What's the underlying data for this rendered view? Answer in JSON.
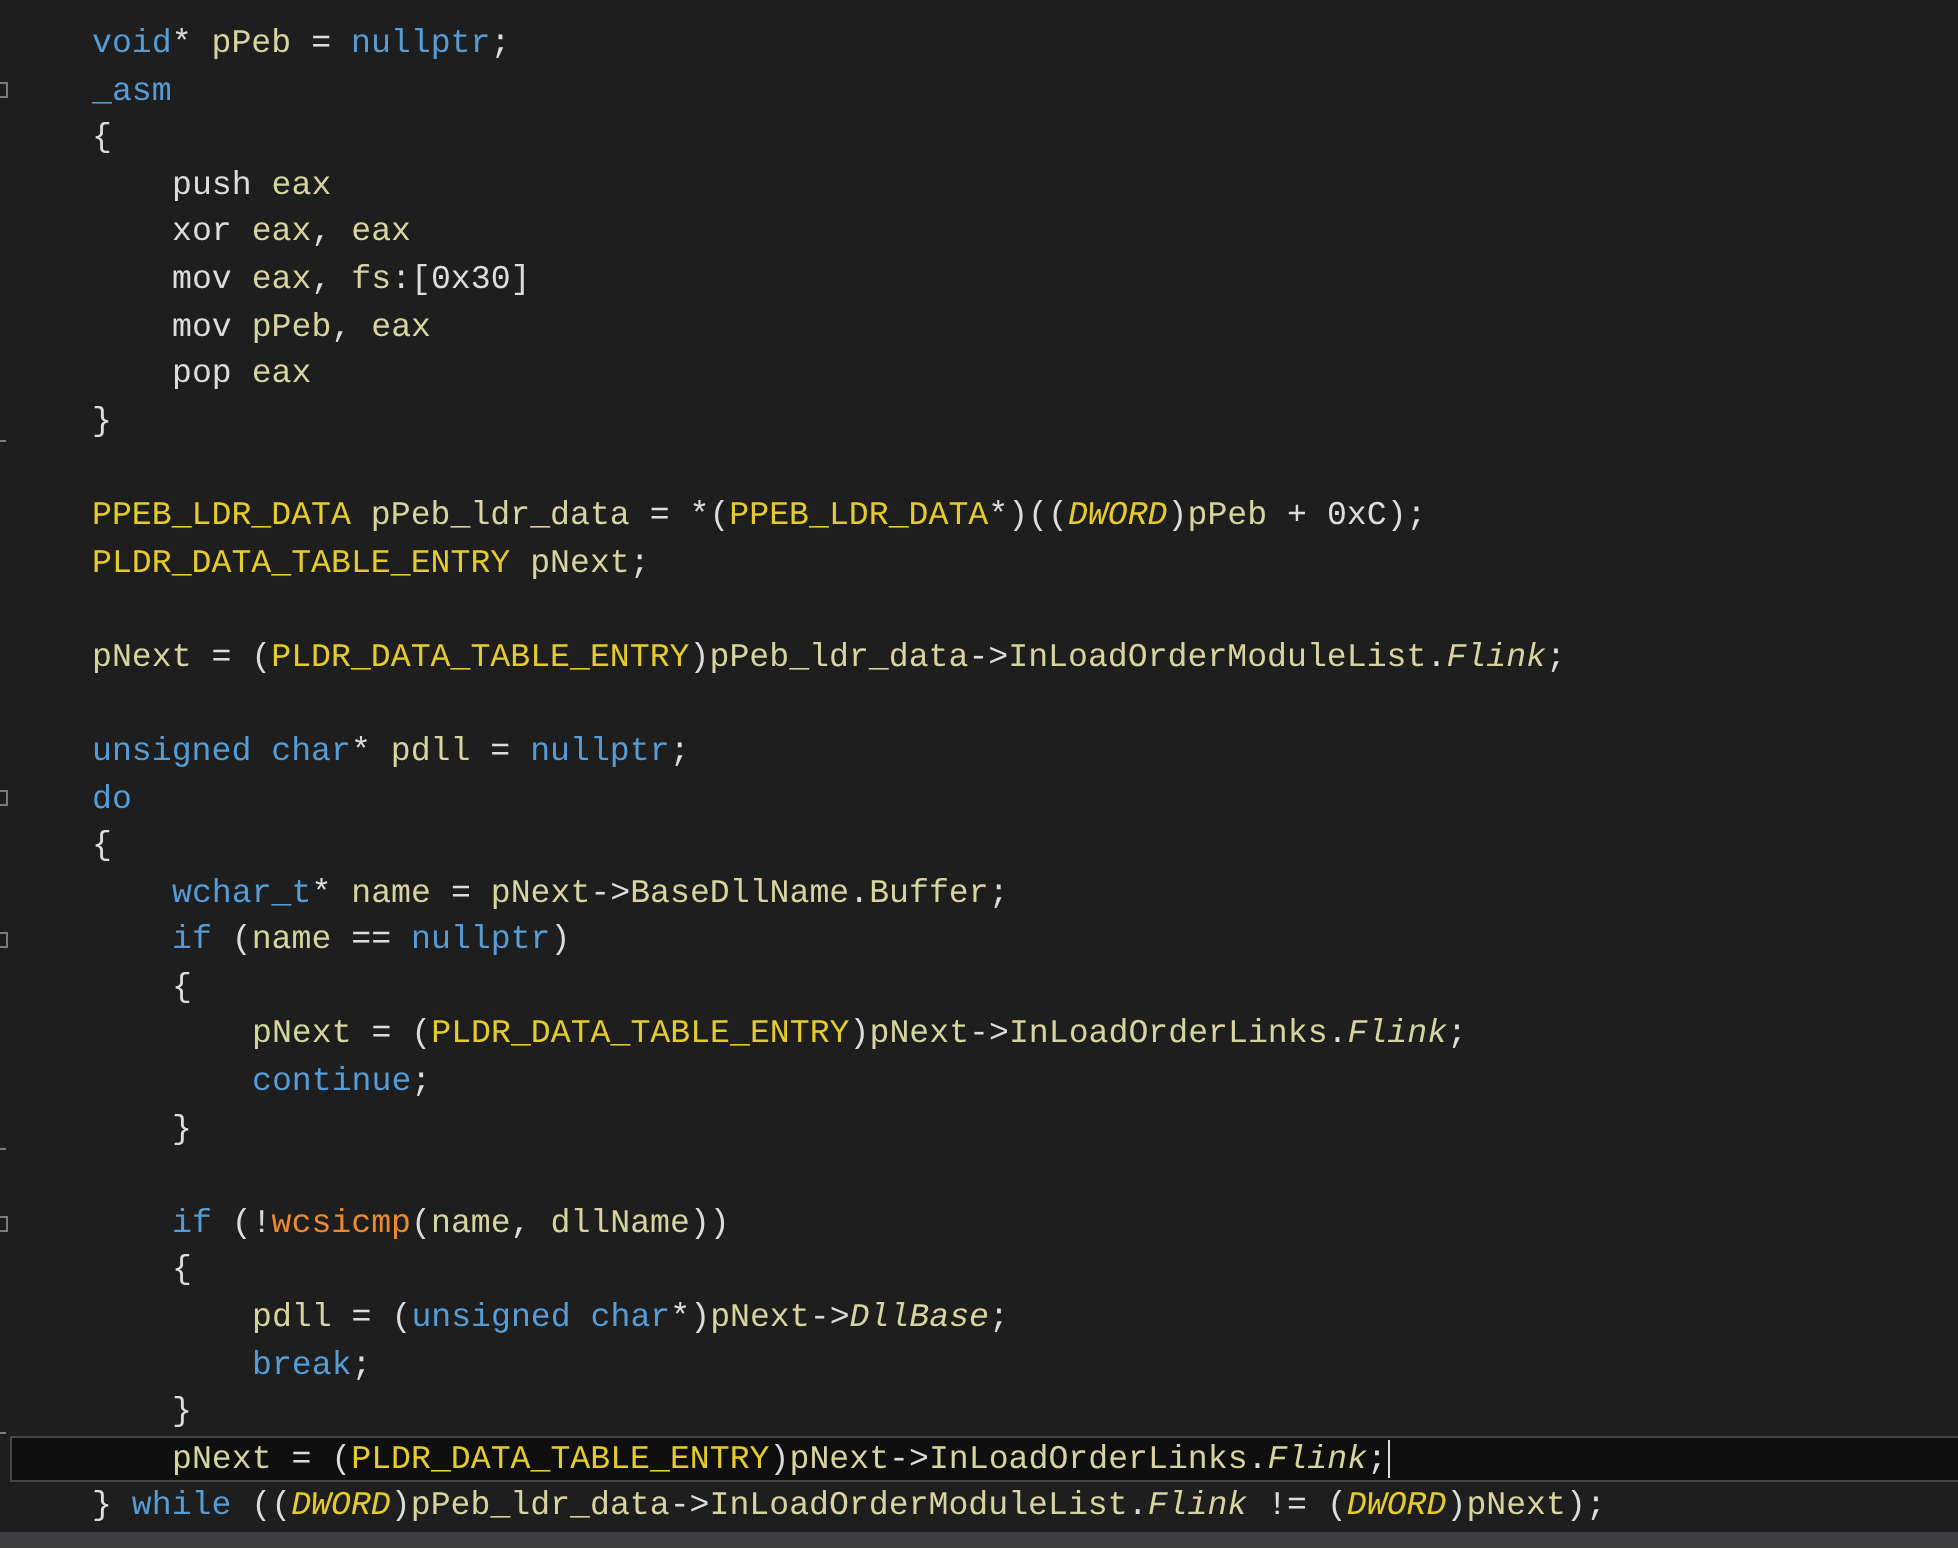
{
  "editor": {
    "lines": [
      {
        "kind": "code",
        "current": false,
        "tokens": [
          {
            "kind": "kw",
            "text": "void"
          },
          {
            "kind": "plain",
            "text": "* "
          },
          {
            "kind": "id",
            "text": "pPeb"
          },
          {
            "kind": "plain",
            "text": " = "
          },
          {
            "kind": "kw",
            "text": "nullptr"
          },
          {
            "kind": "plain",
            "text": ";"
          }
        ]
      },
      {
        "kind": "code",
        "current": false,
        "marker": {
          "kind": "collapse"
        },
        "tokens": [
          {
            "kind": "kw",
            "text": "_asm"
          }
        ]
      },
      {
        "kind": "code",
        "current": false,
        "tokens": [
          {
            "kind": "plain",
            "text": "{"
          }
        ],
        "children": [
          {
            "kind": "code",
            "current": false,
            "tokens": [
              {
                "kind": "plain",
                "text": "push "
              },
              {
                "kind": "id",
                "text": "eax"
              }
            ]
          },
          {
            "kind": "code",
            "current": false,
            "tokens": [
              {
                "kind": "plain",
                "text": "xor "
              },
              {
                "kind": "id",
                "text": "eax"
              },
              {
                "kind": "plain",
                "text": ", "
              },
              {
                "kind": "id",
                "text": "eax"
              }
            ]
          },
          {
            "kind": "code",
            "current": false,
            "tokens": [
              {
                "kind": "plain",
                "text": "mov "
              },
              {
                "kind": "id",
                "text": "eax"
              },
              {
                "kind": "plain",
                "text": ", "
              },
              {
                "kind": "id",
                "text": "fs"
              },
              {
                "kind": "plain",
                "text": ":[0x30]"
              }
            ]
          },
          {
            "kind": "code",
            "current": false,
            "tokens": [
              {
                "kind": "plain",
                "text": "mov "
              },
              {
                "kind": "id",
                "text": "pPeb"
              },
              {
                "kind": "plain",
                "text": ", "
              },
              {
                "kind": "id",
                "text": "eax"
              }
            ]
          },
          {
            "kind": "code",
            "current": false,
            "tokens": [
              {
                "kind": "plain",
                "text": "pop "
              },
              {
                "kind": "id",
                "text": "eax"
              }
            ]
          }
        ]
      },
      {
        "kind": "code",
        "current": false,
        "marker": {
          "kind": "block-end"
        },
        "tokens": [
          {
            "kind": "plain",
            "text": "}"
          }
        ]
      },
      {
        "kind": "blank",
        "current": false
      },
      {
        "kind": "code",
        "current": false,
        "tokens": [
          {
            "kind": "type",
            "text": "PPEB_LDR_DATA"
          },
          {
            "kind": "id",
            "text": " pPeb_ldr_data"
          },
          {
            "kind": "plain",
            "text": " = *("
          },
          {
            "kind": "type",
            "text": "PPEB_LDR_DATA"
          },
          {
            "kind": "plain",
            "text": "*)(("
          },
          {
            "kind": "macro",
            "text": "DWORD"
          },
          {
            "kind": "plain",
            "text": ")"
          },
          {
            "kind": "id",
            "text": "pPeb"
          },
          {
            "kind": "plain",
            "text": " + 0xC);"
          }
        ]
      },
      {
        "kind": "code",
        "current": false,
        "tokens": [
          {
            "kind": "type",
            "text": "PLDR_DATA_TABLE_ENTRY"
          },
          {
            "kind": "id",
            "text": " pNext"
          },
          {
            "kind": "plain",
            "text": ";"
          }
        ]
      },
      {
        "kind": "blank",
        "current": false
      },
      {
        "kind": "code",
        "current": false,
        "tokens": [
          {
            "kind": "id",
            "text": "pNext"
          },
          {
            "kind": "plain",
            "text": " = ("
          },
          {
            "kind": "type",
            "text": "PLDR_DATA_TABLE_ENTRY"
          },
          {
            "kind": "plain",
            "text": ")"
          },
          {
            "kind": "id",
            "text": "pPeb_ldr_data"
          },
          {
            "kind": "plain",
            "text": "->"
          },
          {
            "kind": "id",
            "text": "InLoadOrderModuleList"
          },
          {
            "kind": "plain",
            "text": "."
          },
          {
            "kind": "field",
            "text": "Flink"
          },
          {
            "kind": "plain",
            "text": ";"
          }
        ]
      },
      {
        "kind": "blank",
        "current": false
      },
      {
        "kind": "code",
        "current": false,
        "tokens": [
          {
            "kind": "kw",
            "text": "unsigned char"
          },
          {
            "kind": "plain",
            "text": "* "
          },
          {
            "kind": "id",
            "text": "pdll"
          },
          {
            "kind": "plain",
            "text": " = "
          },
          {
            "kind": "kw",
            "text": "nullptr"
          },
          {
            "kind": "plain",
            "text": ";"
          }
        ]
      },
      {
        "kind": "code",
        "current": false,
        "marker": {
          "kind": "collapse"
        },
        "tokens": [
          {
            "kind": "kw",
            "text": "do"
          }
        ]
      },
      {
        "kind": "code",
        "current": false,
        "tokens": [
          {
            "kind": "plain",
            "text": "{"
          }
        ],
        "children": [
          {
            "kind": "code",
            "current": false,
            "tokens": [
              {
                "kind": "kw",
                "text": "wchar_t"
              },
              {
                "kind": "plain",
                "text": "* "
              },
              {
                "kind": "id",
                "text": "name"
              },
              {
                "kind": "plain",
                "text": " = "
              },
              {
                "kind": "id",
                "text": "pNext"
              },
              {
                "kind": "plain",
                "text": "->"
              },
              {
                "kind": "id",
                "text": "BaseDllName"
              },
              {
                "kind": "plain",
                "text": "."
              },
              {
                "kind": "id",
                "text": "Buffer"
              },
              {
                "kind": "plain",
                "text": ";"
              }
            ]
          },
          {
            "kind": "code",
            "current": false,
            "marker": {
              "kind": "collapse"
            },
            "tokens": [
              {
                "kind": "kw",
                "text": "if"
              },
              {
                "kind": "plain",
                "text": " ("
              },
              {
                "kind": "id",
                "text": "name"
              },
              {
                "kind": "plain",
                "text": " == "
              },
              {
                "kind": "kw",
                "text": "nullptr"
              },
              {
                "kind": "plain",
                "text": ")"
              }
            ]
          },
          {
            "kind": "code",
            "current": false,
            "tokens": [
              {
                "kind": "plain",
                "text": "{"
              }
            ],
            "children": [
              {
                "kind": "code",
                "current": false,
                "tokens": [
                  {
                    "kind": "id",
                    "text": "pNext"
                  },
                  {
                    "kind": "plain",
                    "text": " = ("
                  },
                  {
                    "kind": "type",
                    "text": "PLDR_DATA_TABLE_ENTRY"
                  },
                  {
                    "kind": "plain",
                    "text": ")"
                  },
                  {
                    "kind": "id",
                    "text": "pNext"
                  },
                  {
                    "kind": "plain",
                    "text": "->"
                  },
                  {
                    "kind": "id",
                    "text": "InLoadOrderLinks"
                  },
                  {
                    "kind": "plain",
                    "text": "."
                  },
                  {
                    "kind": "field",
                    "text": "Flink"
                  },
                  {
                    "kind": "plain",
                    "text": ";"
                  }
                ]
              },
              {
                "kind": "code",
                "current": false,
                "tokens": [
                  {
                    "kind": "kw",
                    "text": "continue"
                  },
                  {
                    "kind": "plain",
                    "text": ";"
                  }
                ]
              }
            ]
          },
          {
            "kind": "code",
            "current": false,
            "marker": {
              "kind": "block-end"
            },
            "tokens": [
              {
                "kind": "plain",
                "text": "}"
              }
            ]
          },
          {
            "kind": "blank",
            "current": false
          },
          {
            "kind": "code",
            "current": false,
            "marker": {
              "kind": "collapse"
            },
            "tokens": [
              {
                "kind": "kw",
                "text": "if"
              },
              {
                "kind": "plain",
                "text": " (!"
              },
              {
                "kind": "func",
                "text": "wcsicmp"
              },
              {
                "kind": "plain",
                "text": "("
              },
              {
                "kind": "id",
                "text": "name"
              },
              {
                "kind": "plain",
                "text": ", "
              },
              {
                "kind": "id",
                "text": "dllName"
              },
              {
                "kind": "plain",
                "text": "))"
              }
            ]
          },
          {
            "kind": "code",
            "current": false,
            "tokens": [
              {
                "kind": "plain",
                "text": "{"
              }
            ],
            "children": [
              {
                "kind": "code",
                "current": false,
                "tokens": [
                  {
                    "kind": "id",
                    "text": "pdll"
                  },
                  {
                    "kind": "plain",
                    "text": " = ("
                  },
                  {
                    "kind": "kw",
                    "text": "unsigned char"
                  },
                  {
                    "kind": "plain",
                    "text": "*)"
                  },
                  {
                    "kind": "id",
                    "text": "pNext"
                  },
                  {
                    "kind": "plain",
                    "text": "->"
                  },
                  {
                    "kind": "field",
                    "text": "DllBase"
                  },
                  {
                    "kind": "plain",
                    "text": ";"
                  }
                ]
              },
              {
                "kind": "code",
                "current": false,
                "tokens": [
                  {
                    "kind": "kw",
                    "text": "break"
                  },
                  {
                    "kind": "plain",
                    "text": ";"
                  }
                ]
              }
            ]
          },
          {
            "kind": "code",
            "current": false,
            "marker": {
              "kind": "block-end"
            },
            "tokens": [
              {
                "kind": "plain",
                "text": "}"
              }
            ]
          },
          {
            "kind": "code",
            "current": true,
            "tokens": [
              {
                "kind": "id",
                "text": "pNext"
              },
              {
                "kind": "plain",
                "text": " = ("
              },
              {
                "kind": "type",
                "text": "PLDR_DATA_TABLE_ENTRY"
              },
              {
                "kind": "plain",
                "text": ")"
              },
              {
                "kind": "id",
                "text": "pNext"
              },
              {
                "kind": "plain",
                "text": "->"
              },
              {
                "kind": "id",
                "text": "InLoadOrderLinks"
              },
              {
                "kind": "plain",
                "text": "."
              },
              {
                "kind": "field",
                "text": "Flink"
              },
              {
                "kind": "plain",
                "text": ";"
              }
            ]
          }
        ]
      },
      {
        "kind": "code",
        "current": false,
        "tokens": [
          {
            "kind": "plain",
            "text": "} "
          },
          {
            "kind": "kw",
            "text": "while"
          },
          {
            "kind": "plain",
            "text": " (("
          },
          {
            "kind": "macro",
            "text": "DWORD"
          },
          {
            "kind": "plain",
            "text": ")"
          },
          {
            "kind": "id",
            "text": "pPeb_ldr_data"
          },
          {
            "kind": "plain",
            "text": "->"
          },
          {
            "kind": "id",
            "text": "InLoadOrderModuleList"
          },
          {
            "kind": "plain",
            "text": "."
          },
          {
            "kind": "field",
            "text": "Flink"
          },
          {
            "kind": "plain",
            "text": " != ("
          },
          {
            "kind": "macro",
            "text": "DWORD"
          },
          {
            "kind": "plain",
            "text": ")"
          },
          {
            "kind": "id",
            "text": "pNext"
          },
          {
            "kind": "plain",
            "text": ");"
          }
        ]
      }
    ]
  }
}
